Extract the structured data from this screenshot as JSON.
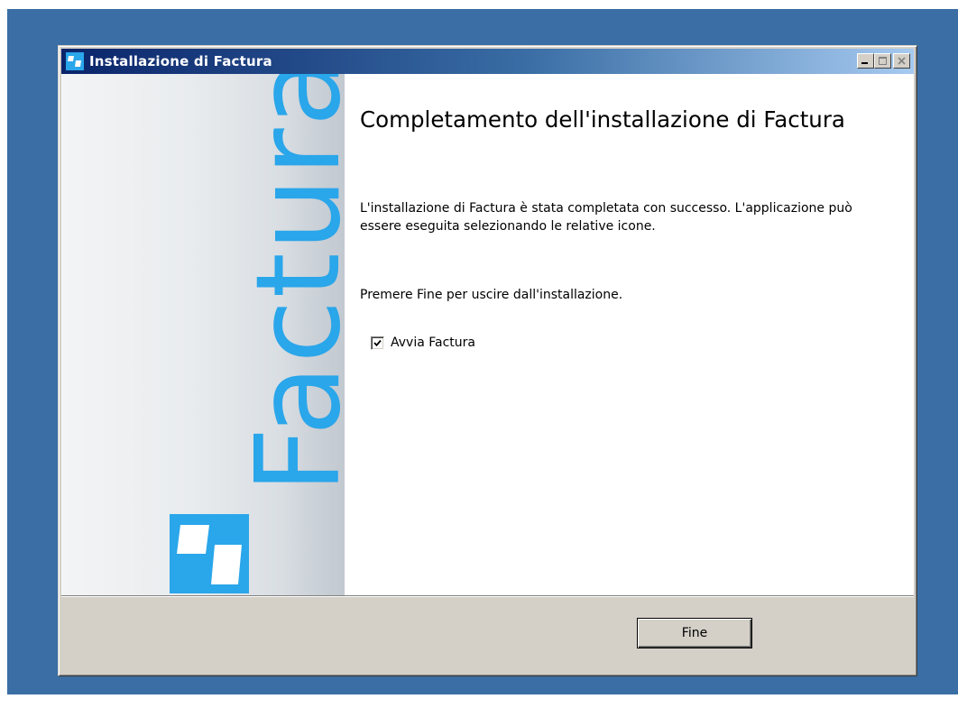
{
  "window": {
    "title": "Installazione di Factura",
    "controls": [
      "minimize-icon",
      "maximize-icon",
      "close-icon"
    ]
  },
  "sidebar": {
    "brand_text": "Factura",
    "logo_icon": "factura-logo-icon",
    "accent_color": "#2aa6ea"
  },
  "main": {
    "heading": "Completamento dell'installazione di Factura",
    "paragraph1": "L'installazione di Factura è stata completata con successo. L'applicazione può essere eseguita selezionando le relative icone.",
    "paragraph2": "Premere Fine per uscire dall'installazione.",
    "launch_checkbox": {
      "label": "Avvia Factura",
      "checked": true
    }
  },
  "footer": {
    "finish_label": "Fine"
  },
  "colors": {
    "desktop": "#3a6ea5",
    "titlebar_start": "#0a246a",
    "titlebar_end": "#a6caf0",
    "dialog_face": "#d4d0c8"
  }
}
